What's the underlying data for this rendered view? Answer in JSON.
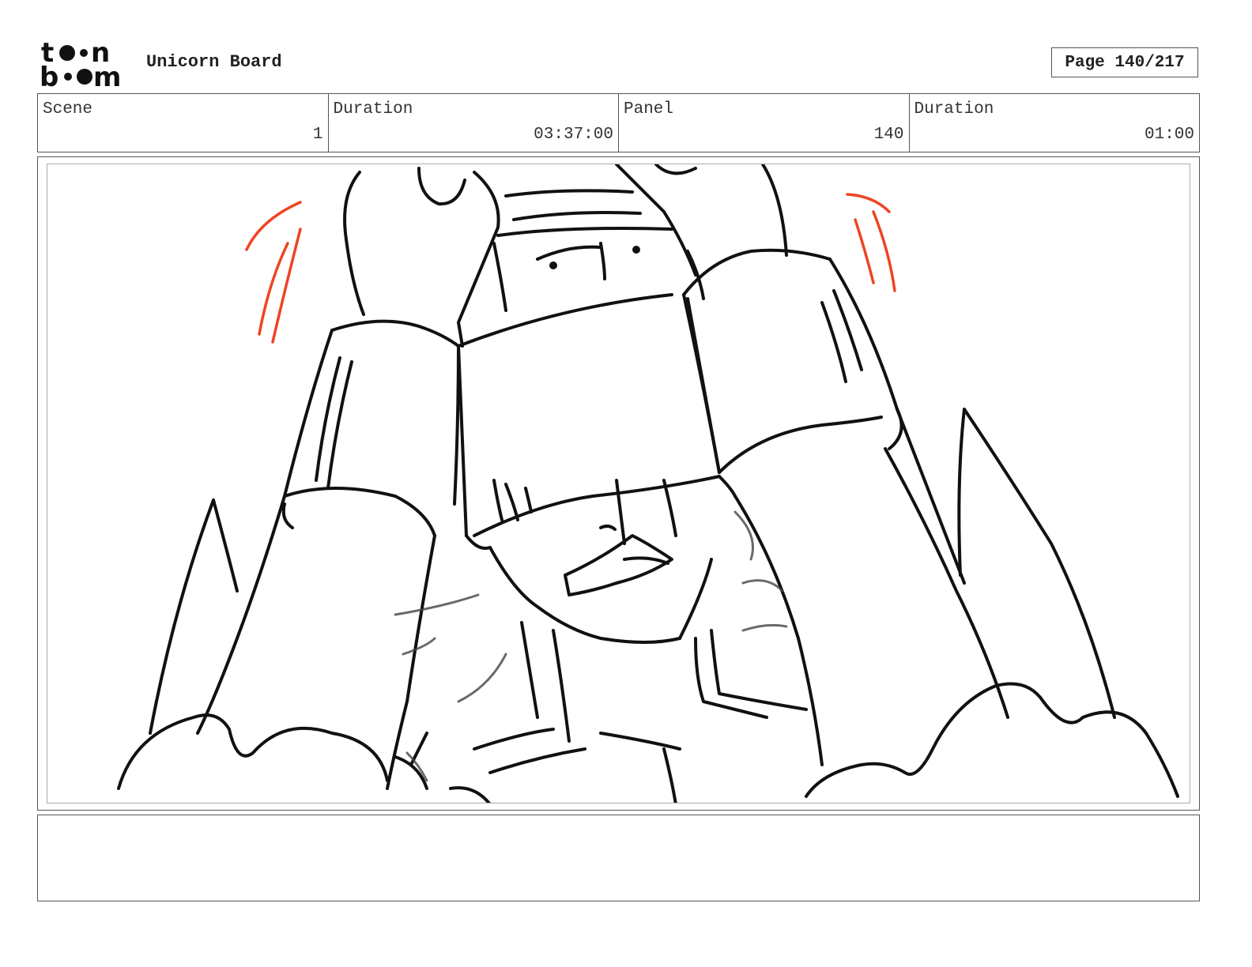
{
  "header": {
    "logo_top": "toon",
    "logo_bottom": "boom",
    "app_title": "Unicorn Board",
    "page_label": "Page 140/217"
  },
  "info": {
    "scene_label": "Scene",
    "scene_value": "1",
    "scene_duration_label": "Duration",
    "scene_duration_value": "03:37:00",
    "panel_label": "Panel",
    "panel_value": "140",
    "panel_duration_label": "Duration",
    "panel_duration_value": "01:00"
  },
  "notes": {
    "text": ""
  },
  "colors": {
    "ink": "#111111",
    "accent_strokes": "#ee4422",
    "border": "#555555"
  }
}
